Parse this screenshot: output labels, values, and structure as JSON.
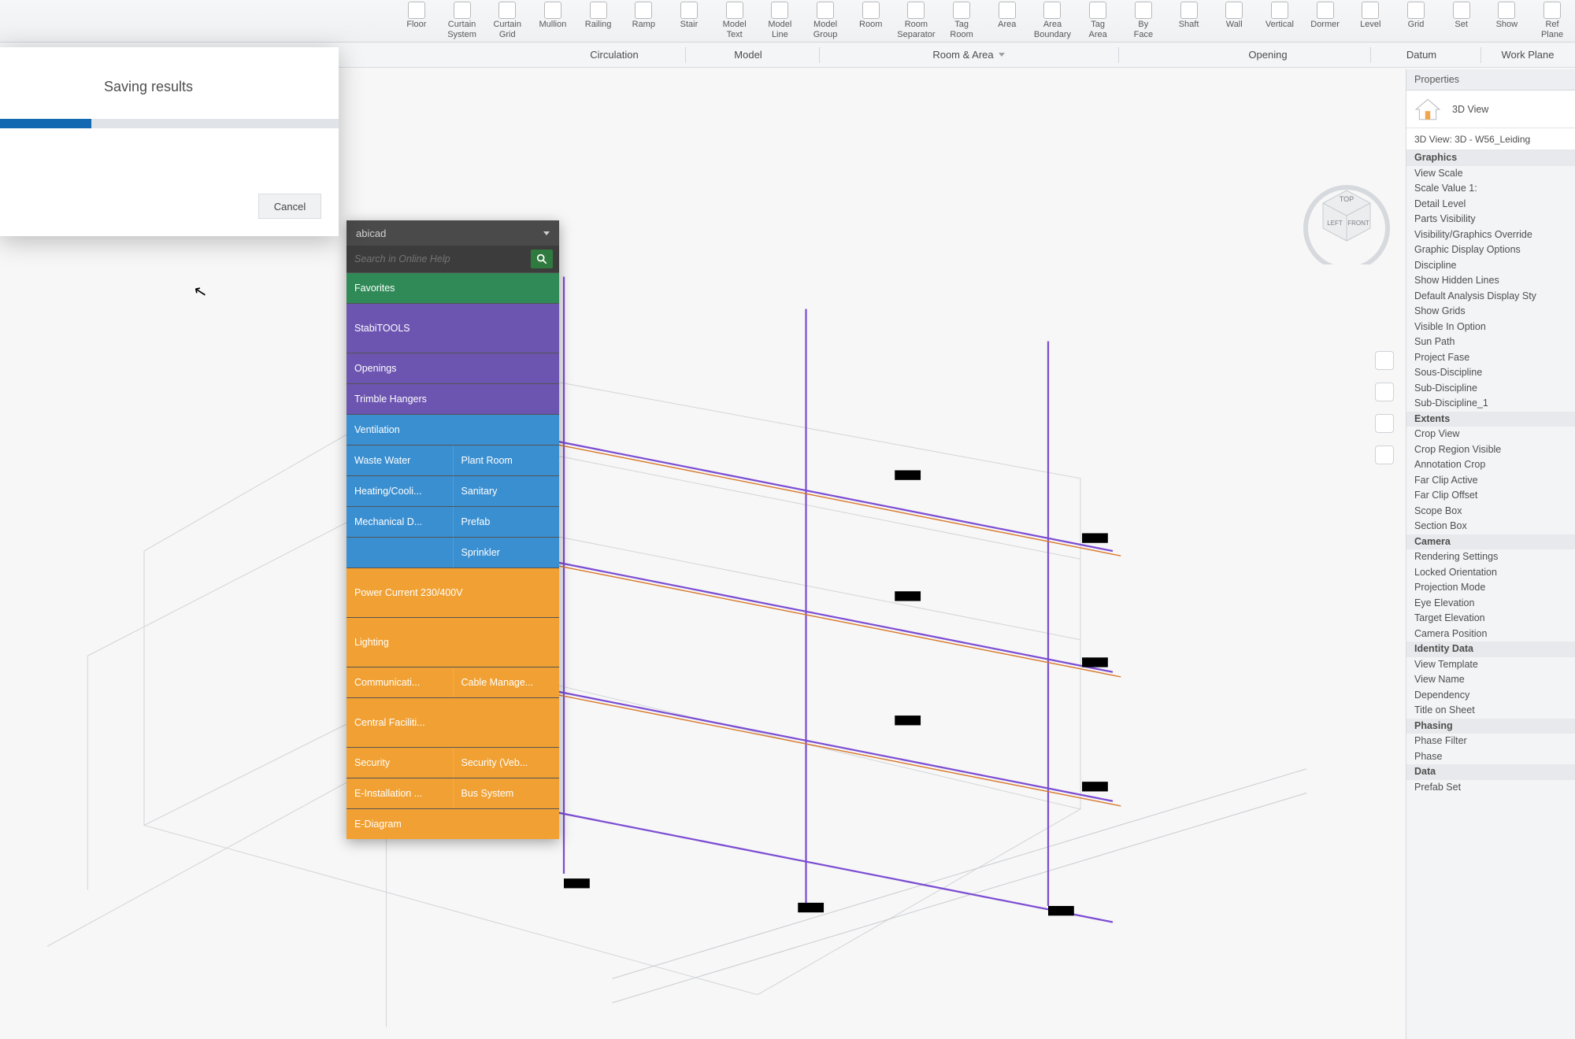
{
  "ribbon": {
    "details": [
      {
        "l1": "Floor"
      },
      {
        "l1": "Curtain",
        "l2": "System"
      },
      {
        "l1": "Curtain",
        "l2": "Grid"
      },
      {
        "l1": "Mullion"
      },
      {
        "l1": "Railing"
      },
      {
        "l1": "Ramp"
      },
      {
        "l1": "Stair"
      },
      {
        "l1": "Model",
        "l2": "Text"
      },
      {
        "l1": "Model",
        "l2": "Line"
      },
      {
        "l1": "Model",
        "l2": "Group"
      },
      {
        "l1": "Room"
      },
      {
        "l1": "Room",
        "l2": "Separator"
      },
      {
        "l1": "Tag",
        "l2": "Room"
      },
      {
        "l1": "Area"
      },
      {
        "l1": "Area",
        "l2": "Boundary"
      },
      {
        "l1": "Tag",
        "l2": "Area"
      },
      {
        "l1": "By",
        "l2": "Face"
      },
      {
        "l1": "Shaft"
      },
      {
        "l1": "Wall"
      },
      {
        "l1": "Vertical"
      },
      {
        "l1": "Dormer"
      },
      {
        "l1": "Level"
      },
      {
        "l1": "Grid"
      },
      {
        "l1": "Set"
      },
      {
        "l1": "Show"
      },
      {
        "l1": "Ref",
        "l2": "Plane"
      }
    ],
    "groups": {
      "circulation": "Circulation",
      "model": "Model",
      "room_area": "Room & Area",
      "opening": "Opening",
      "datum": "Datum",
      "work_plane": "Work Plane"
    }
  },
  "properties": {
    "title": "Properties",
    "view_type": "3D View",
    "view_name": "3D View: 3D - W56_Leiding",
    "sections": {
      "graphics": {
        "title": "Graphics",
        "items": [
          "View Scale",
          "Scale Value   1:",
          "Detail Level",
          "Parts Visibility",
          "Visibility/Graphics Override",
          "Graphic Display Options",
          "Discipline",
          "Show Hidden Lines",
          "Default Analysis Display Sty",
          "Show Grids",
          "Visible In Option",
          "Sun Path",
          "Project Fase",
          "Sous-Discipline",
          "Sub-Discipline",
          "Sub-Discipline_1"
        ]
      },
      "extents": {
        "title": "Extents",
        "items": [
          "Crop View",
          "Crop Region Visible",
          "Annotation Crop",
          "Far Clip Active",
          "Far Clip Offset",
          "Scope Box",
          "Section Box"
        ]
      },
      "camera": {
        "title": "Camera",
        "items": [
          "Rendering Settings",
          "Locked Orientation",
          "Projection Mode",
          "Eye Elevation",
          "Target Elevation",
          "Camera Position"
        ]
      },
      "identity": {
        "title": "Identity Data",
        "items": [
          "View Template",
          "View Name",
          "Dependency",
          "Title on Sheet"
        ]
      },
      "phasing": {
        "title": "Phasing",
        "items": [
          "Phase Filter",
          "Phase"
        ]
      },
      "data": {
        "title": "Data",
        "items": [
          "Prefab Set"
        ]
      }
    }
  },
  "viewcube": {
    "top": "TOP",
    "left": "LEFT",
    "front": "FRONT"
  },
  "palette": {
    "title": "abicad",
    "search_placeholder": "Search in Online Help",
    "rows": [
      [
        {
          "label": "Favorites",
          "color": "c-green"
        }
      ],
      [
        {
          "label": "StabiTOOLS",
          "color": "c-purple",
          "tall": true
        }
      ],
      [
        {
          "label": "Openings",
          "color": "c-purple"
        }
      ],
      [
        {
          "label": "Trimble Hangers",
          "color": "c-purple"
        }
      ],
      [
        {
          "label": "Ventilation",
          "color": "c-blue"
        }
      ],
      [
        {
          "label": "Waste Water",
          "color": "c-blue"
        },
        {
          "label": "Plant Room",
          "color": "c-blue"
        }
      ],
      [
        {
          "label": "Heating/Cooli...",
          "color": "c-blue"
        },
        {
          "label": "Sanitary",
          "color": "c-blue"
        }
      ],
      [
        {
          "label": "Mechanical D...",
          "color": "c-blue"
        },
        {
          "label": "Prefab",
          "color": "c-blue"
        }
      ],
      [
        {
          "label": "",
          "color": "c-blue"
        },
        {
          "label": "Sprinkler",
          "color": "c-blue"
        }
      ],
      [
        {
          "label": "Power Current 230/400V",
          "color": "c-orange",
          "tall": true
        }
      ],
      [
        {
          "label": "Lighting",
          "color": "c-orange",
          "tall": true
        }
      ],
      [
        {
          "label": "Communicati...",
          "color": "c-orange"
        },
        {
          "label": "Cable Manage...",
          "color": "c-orange"
        }
      ],
      [
        {
          "label": "Central Faciliti...",
          "color": "c-orange",
          "tall": true
        }
      ],
      [
        {
          "label": "Security",
          "color": "c-orange"
        },
        {
          "label": "Security (Veb...",
          "color": "c-orange"
        }
      ],
      [
        {
          "label": "E-Installation ...",
          "color": "c-orange"
        },
        {
          "label": "Bus System",
          "color": "c-orange"
        }
      ],
      [
        {
          "label": "E-Diagram",
          "color": "c-orange"
        }
      ]
    ]
  },
  "save_dialog": {
    "title": "Saving results",
    "progress_pct": 27,
    "cancel": "Cancel"
  }
}
